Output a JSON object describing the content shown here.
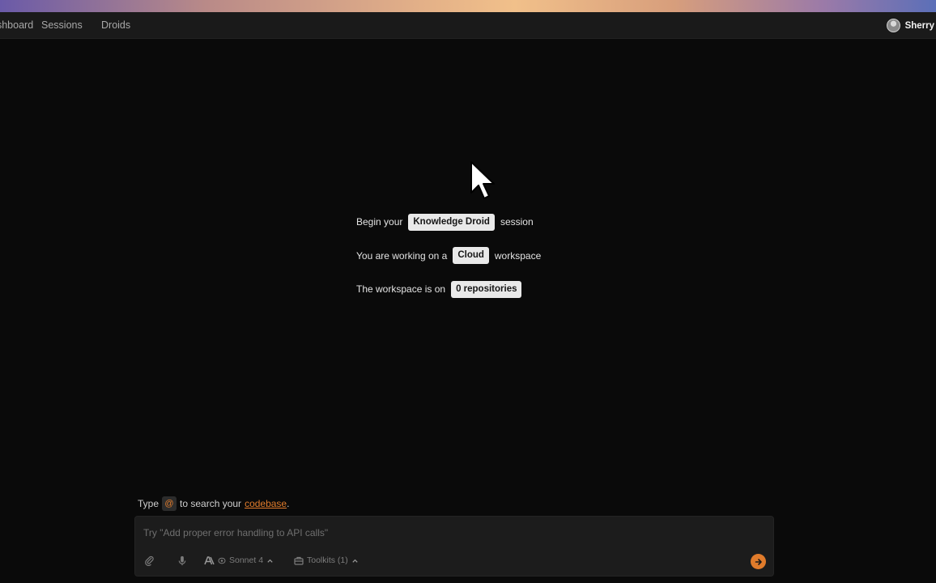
{
  "nav": {
    "dashboard": "Dashboard",
    "sessions": "Sessions",
    "droids": "Droids"
  },
  "user": {
    "name": "Sherry"
  },
  "intro": {
    "line1_prefix": "Begin your",
    "line1_chip": "Knowledge Droid",
    "line1_suffix": "session",
    "line2_prefix": "You are working on a",
    "line2_chip": "Cloud",
    "line2_suffix": "workspace",
    "line3_prefix": "The workspace is on",
    "line3_chip": "0 repositories"
  },
  "hint": {
    "prefix": "Type",
    "symbol": "@",
    "middle": "to search your",
    "link": "codebase",
    "suffix": "."
  },
  "composer": {
    "placeholder": "Try \"Add proper error handling to API calls\"",
    "model_label": "Sonnet 4",
    "toolkits_label": "Toolkits (1)"
  },
  "colors": {
    "accent": "#e07b2b",
    "background": "#0a0a0a",
    "chip_bg": "#e9e9e9"
  },
  "icons": [
    "paperclip-icon",
    "microphone-icon",
    "anthropic-icon",
    "brain-icon",
    "chevron-up-icon",
    "toolbox-icon",
    "arrow-right-icon",
    "mouse-cursor-icon"
  ]
}
